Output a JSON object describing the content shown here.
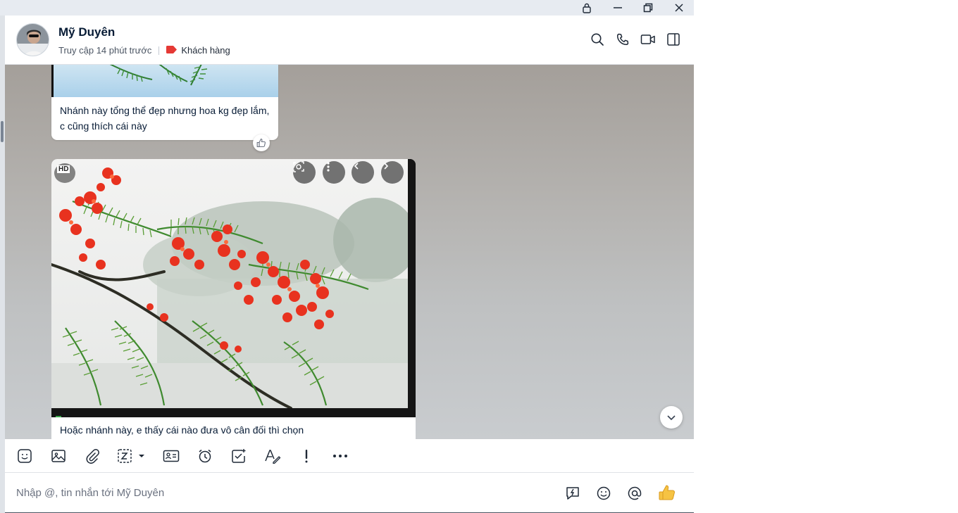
{
  "contact": {
    "name": "Mỹ Duyên",
    "status": "Truy cập 14 phút trước",
    "label": "Khách hàng",
    "label_color": "#e53935"
  },
  "window_controls": [
    "lock-icon",
    "minimize-icon",
    "restore-icon",
    "close-icon"
  ],
  "header_actions": [
    "search-icon",
    "phone-icon",
    "video-icon",
    "sidebar-toggle-icon"
  ],
  "messages": [
    {
      "text": "Nhánh này tổng thể đẹp nhưng hoa kg đẹp lắm, c cũng thích cái này",
      "reaction": "thumbs-up-icon"
    },
    {
      "text": "Hoặc nhánh này, e thấy cái nào đưa vô cân đối thì chọn",
      "badge": "HD"
    }
  ],
  "toolbar": [
    "sticker-icon",
    "image-icon",
    "attach-icon",
    "screenshot-icon",
    "contact-card-icon",
    "reminder-icon",
    "task-icon",
    "format-icon",
    "urgent-icon",
    "more-icon"
  ],
  "input": {
    "placeholder": "Nhập @, tin nhắn tới Mỹ Duyên"
  },
  "input_actions": [
    "quick-message-icon",
    "emoji-icon",
    "mention-icon",
    "thumbs-up-send-icon"
  ],
  "colors": {
    "accent": "#0068ff",
    "text": "#081c36"
  }
}
